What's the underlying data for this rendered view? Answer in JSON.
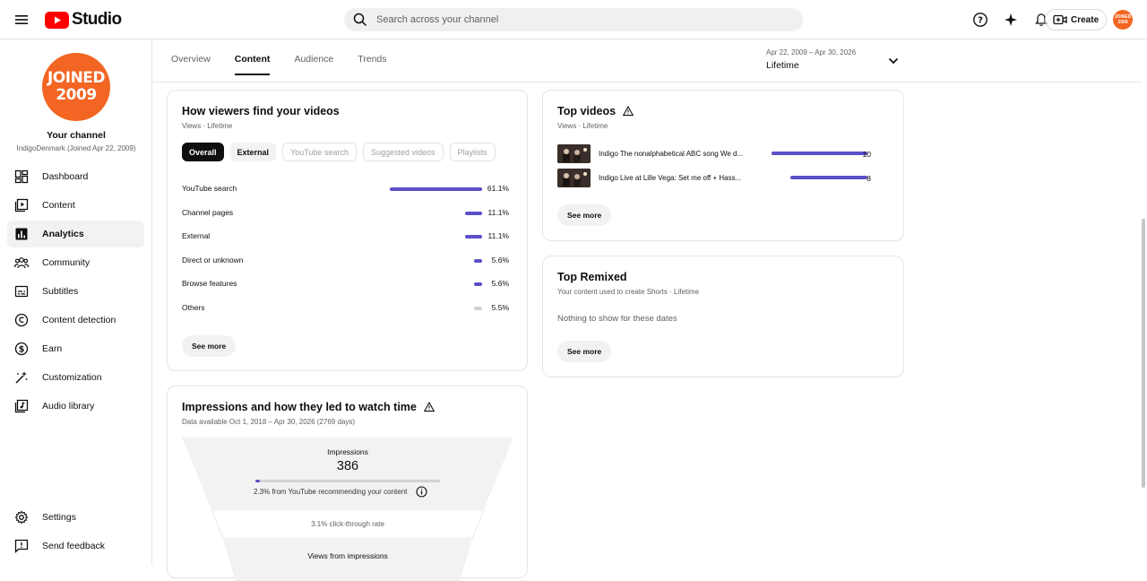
{
  "header": {
    "logo_text": "Studio",
    "search_placeholder": "Search across your channel",
    "create_label": "Create",
    "avatar_text": "JOINED 2009",
    "brand_color": "#ff0000",
    "icons": [
      "menu-icon",
      "help-icon",
      "sparkle-icon",
      "notifications-icon",
      "create-video-icon"
    ]
  },
  "sidebar": {
    "avatar_line1": "JOINED",
    "avatar_line2": "2009",
    "channel_name": "Your channel",
    "channel_sub": "IndigoDenmark (Joined Apr 22, 2009)",
    "items": [
      {
        "label": "Dashboard",
        "icon": "dashboard-icon"
      },
      {
        "label": "Content",
        "icon": "content-icon"
      },
      {
        "label": "Analytics",
        "icon": "analytics-icon",
        "active": true
      },
      {
        "label": "Community",
        "icon": "community-icon"
      },
      {
        "label": "Subtitles",
        "icon": "subtitles-icon"
      },
      {
        "label": "Content detection",
        "icon": "copyright-icon"
      },
      {
        "label": "Earn",
        "icon": "dollar-icon"
      },
      {
        "label": "Customization",
        "icon": "magic-wand-icon"
      },
      {
        "label": "Audio library",
        "icon": "audio-library-icon"
      }
    ],
    "bottom": [
      {
        "label": "Settings",
        "icon": "gear-icon"
      },
      {
        "label": "Send feedback",
        "icon": "feedback-icon"
      }
    ]
  },
  "tabs": [
    "Overview",
    "Content",
    "Audience",
    "Trends"
  ],
  "active_tab": "Content",
  "date_range": {
    "range": "Apr 22, 2009 – Apr 30, 2026",
    "label": "Lifetime"
  },
  "traffic": {
    "title": "How viewers find your videos",
    "sub": "Views · Lifetime",
    "chips": [
      "Overall",
      "External",
      "YouTube search",
      "Suggested videos",
      "Playlists"
    ],
    "rows": [
      {
        "label": "YouTube search",
        "pct": "61.1%",
        "value": 61.1
      },
      {
        "label": "Channel pages",
        "pct": "11.1%",
        "value": 11.1
      },
      {
        "label": "External",
        "pct": "11.1%",
        "value": 11.1
      },
      {
        "label": "Direct or unknown",
        "pct": "5.6%",
        "value": 5.6
      },
      {
        "label": "Browse features",
        "pct": "5.6%",
        "value": 5.6
      },
      {
        "label": "Others",
        "pct": "5.5%",
        "value": 5.5
      }
    ],
    "see_more": "See more",
    "bar_color": "#5b4fc9",
    "others_color": "#cfcfcf"
  },
  "impressions": {
    "title": "Impressions and how they led to watch time",
    "sub": "Data available Oct 1, 2018 – Apr 30, 2026 (2769 days)",
    "impressions_label": "Impressions",
    "impressions_value": "386",
    "recommending": "2.3% from YouTube recommending your content",
    "recommending_fraction": 0.023,
    "ctr": "3.1% click-through rate",
    "views_label": "Views from impressions"
  },
  "top_videos": {
    "title": "Top videos",
    "sub": "Views · Lifetime",
    "videos": [
      {
        "title": "Indigo The nonalphabetical ABC song We d...",
        "views": 10
      },
      {
        "title": "Indigo Live at Lille Vega: Set me off + Hass...",
        "views": 8
      }
    ],
    "max_views": 10,
    "see_more": "See more"
  },
  "top_remixed": {
    "title": "Top Remixed",
    "sub": "Your content used to create Shorts · Lifetime",
    "empty": "Nothing to show for these dates",
    "see_more": "See more"
  }
}
